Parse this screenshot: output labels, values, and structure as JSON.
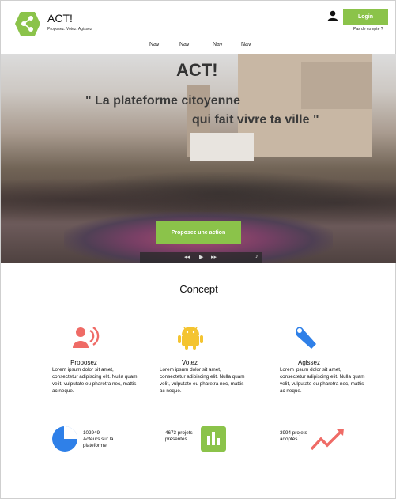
{
  "header": {
    "brand_title": "ACT!",
    "brand_tagline": "Proposez. Votez. Agissez",
    "login_label": "Login",
    "no_account": "Pas de compte ?"
  },
  "nav": {
    "items": [
      "Nav",
      "Nav",
      "Nav",
      "Nav"
    ]
  },
  "hero": {
    "title": "ACT!",
    "quote_line1": "\" La plateforme citoyenne",
    "quote_line2": "qui fait vivre ta ville \"",
    "cta_label": "Proposez une action",
    "media_controls": {
      "rewind": "◂◂",
      "play": "▶",
      "forward": "▸▸",
      "volume": "♪"
    }
  },
  "concept": {
    "title": "Concept",
    "features": [
      {
        "title": "Proposez",
        "text": "Lorem ipsum dolor sit amet, consectetur adipiscing elit. Nulla quam velit, vulputate eu pharetra nec, mattis ac neque.",
        "icon": "megaphone-person-icon"
      },
      {
        "title": "Votez",
        "text": "Lorem ipsum dolor sit amet, consectetur adipiscing elit. Nulla quam velit, vulputate eu pharetra nec, mattis ac neque.",
        "icon": "android-icon"
      },
      {
        "title": "Agissez",
        "text": "Lorem ipsum dolor sit amet, consectetur adipiscing elit. Nulla quam velit, vulputate eu pharetra nec, mattis ac neque.",
        "icon": "wrench-icon"
      }
    ]
  },
  "stats": [
    {
      "line1": "102949",
      "line2": "Acteurs sur la",
      "line3": "plateforme",
      "icon": "pie-chart-icon"
    },
    {
      "line1": "4673 projets",
      "line2": "présentés",
      "icon": "bar-chart-icon"
    },
    {
      "line1": "3994 projets",
      "line2": "adoptés",
      "icon": "trending-line-icon"
    }
  ],
  "colors": {
    "accent": "#8bc34a",
    "red": "#ef6b66",
    "blue": "#2f80e8",
    "yellow": "#f4c430"
  }
}
